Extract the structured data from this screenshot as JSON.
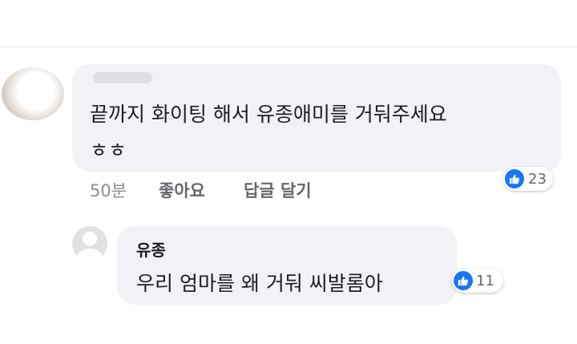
{
  "comment": {
    "text_line1": "끝까지 화이팅 해서 유종애미를 거둬주세요",
    "text_line2": "ㅎㅎ",
    "reaction_count": "23",
    "time": "50분",
    "like_label": "좋아요",
    "reply_label": "답글 달기"
  },
  "reply": {
    "author": "유종",
    "text": "우리 엄마를 왜 거둬 씨발롬아",
    "reaction_count": "11"
  },
  "colors": {
    "bubble": "#f0f2f5",
    "like_blue": "#1877f2",
    "meta_gray": "#65676b"
  }
}
